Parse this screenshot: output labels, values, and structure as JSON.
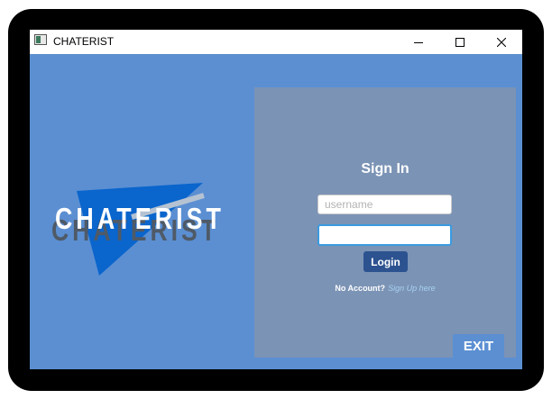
{
  "window": {
    "title": "CHATERIST",
    "controls": {
      "minimize": "minimize-icon",
      "maximize": "maximize-icon",
      "close": "close-icon"
    }
  },
  "colors": {
    "background": "#5b8fd2",
    "panel": "#7b93b5",
    "logo_triangle": "#0a65cc",
    "button": "#2c5290",
    "link": "#a7d2f2"
  },
  "logo": {
    "text": "CHATERIST"
  },
  "login": {
    "heading": "Sign In",
    "username_placeholder": "username",
    "password_value": "",
    "login_label": "Login",
    "no_account_label": "No Account?",
    "signup_label": "Sign Up here"
  },
  "exit_label": "EXIT"
}
